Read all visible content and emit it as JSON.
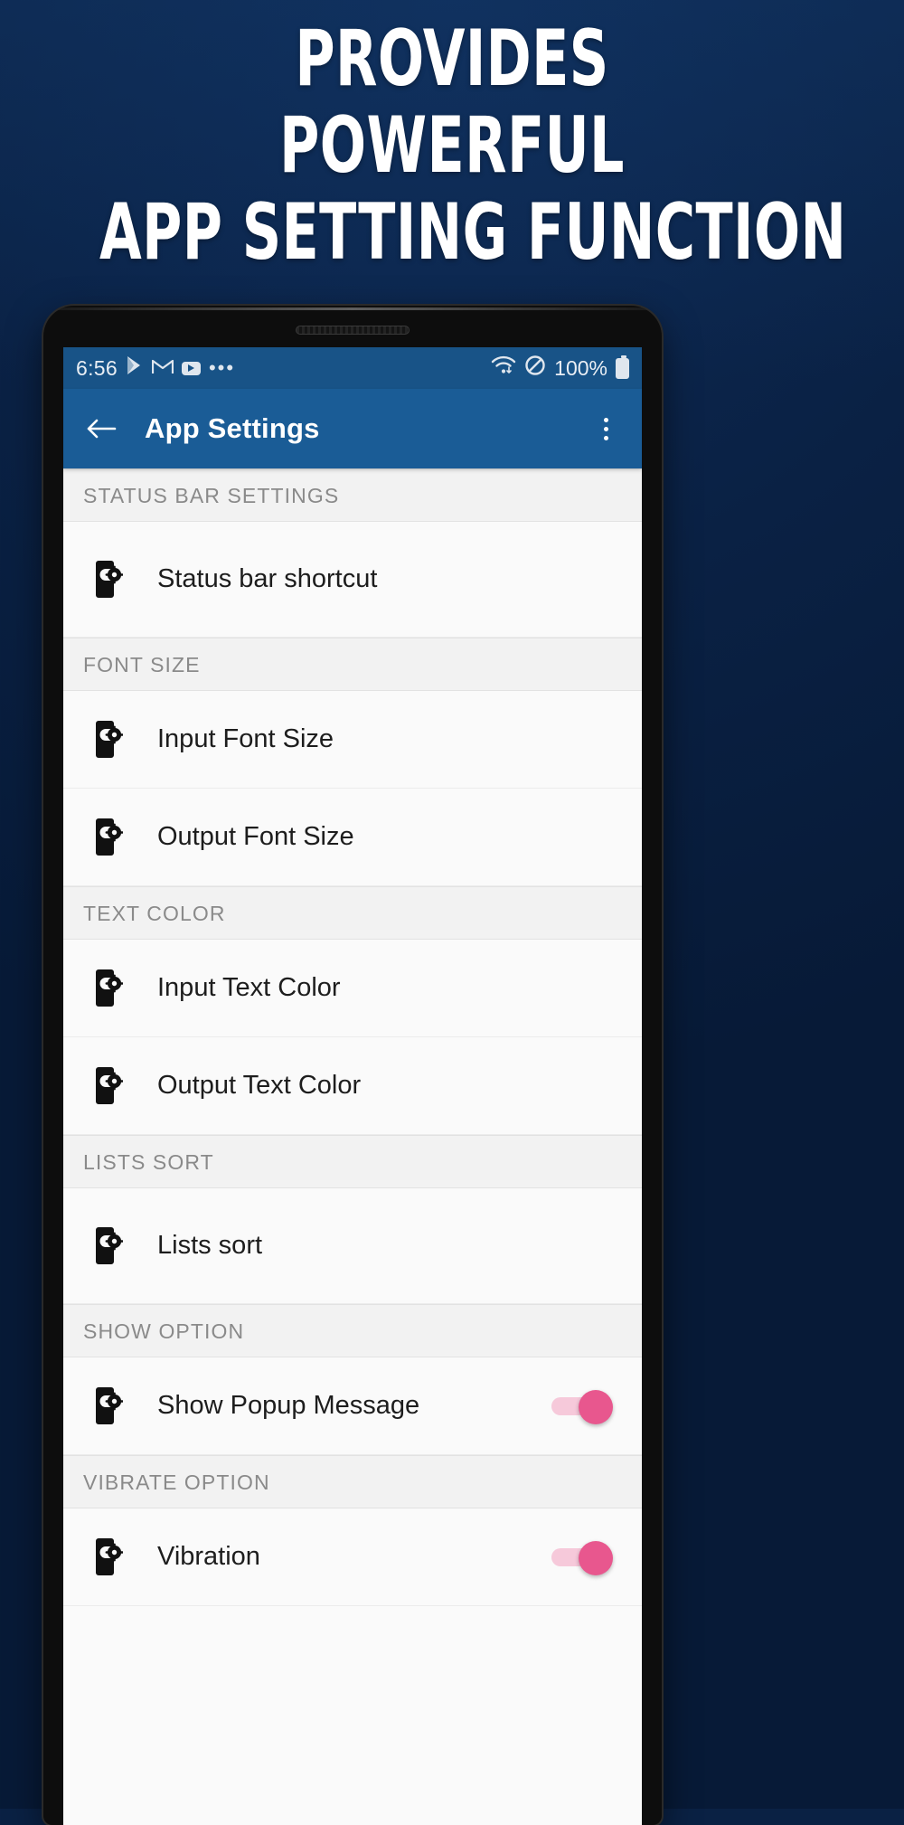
{
  "promo": {
    "background_color": "#0a2144",
    "headline_lines": [
      "PROVIDES",
      "POWERFUL",
      "APP SETTING FUNCTION"
    ]
  },
  "phone": {
    "statusbar": {
      "time": "6:56",
      "left_icons": [
        "play-store-icon",
        "gmail-icon",
        "youtube-icon",
        "more-notifications-icon"
      ],
      "overflow_dots": "•••",
      "wifi_icon": "wifi-data-icon",
      "dnd_icon": "do-not-disturb-icon",
      "battery_percent": "100%",
      "battery_icon": "battery-full-icon",
      "background_color": "#185387"
    },
    "appbar": {
      "back_icon": "back-arrow-icon",
      "title": "App Settings",
      "overflow_icon": "more-vert-icon",
      "background_color": "#1a5c96"
    },
    "settings": [
      {
        "section": "STATUS BAR SETTINGS",
        "rows": [
          {
            "icon": "phone-settings-icon",
            "label": "Status bar shortcut",
            "toggle": null
          }
        ]
      },
      {
        "section": "FONT SIZE",
        "rows": [
          {
            "icon": "phone-settings-icon",
            "label": "Input Font Size",
            "toggle": null
          },
          {
            "icon": "phone-settings-icon",
            "label": "Output Font Size",
            "toggle": null
          }
        ]
      },
      {
        "section": "TEXT COLOR",
        "rows": [
          {
            "icon": "phone-settings-icon",
            "label": "Input Text Color",
            "toggle": null
          },
          {
            "icon": "phone-settings-icon",
            "label": "Output Text Color",
            "toggle": null
          }
        ]
      },
      {
        "section": "LISTS SORT",
        "rows": [
          {
            "icon": "phone-settings-icon",
            "label": "Lists sort",
            "toggle": null
          }
        ]
      },
      {
        "section": "SHOW OPTION",
        "rows": [
          {
            "icon": "phone-settings-icon",
            "label": "Show Popup Message",
            "toggle": "on"
          }
        ]
      },
      {
        "section": "VIBRATE OPTION",
        "rows": [
          {
            "icon": "phone-settings-icon",
            "label": "Vibration",
            "toggle": "on"
          }
        ]
      }
    ],
    "toggle_on_color": "#e8578e",
    "toggle_track_color": "#f6c9da"
  }
}
